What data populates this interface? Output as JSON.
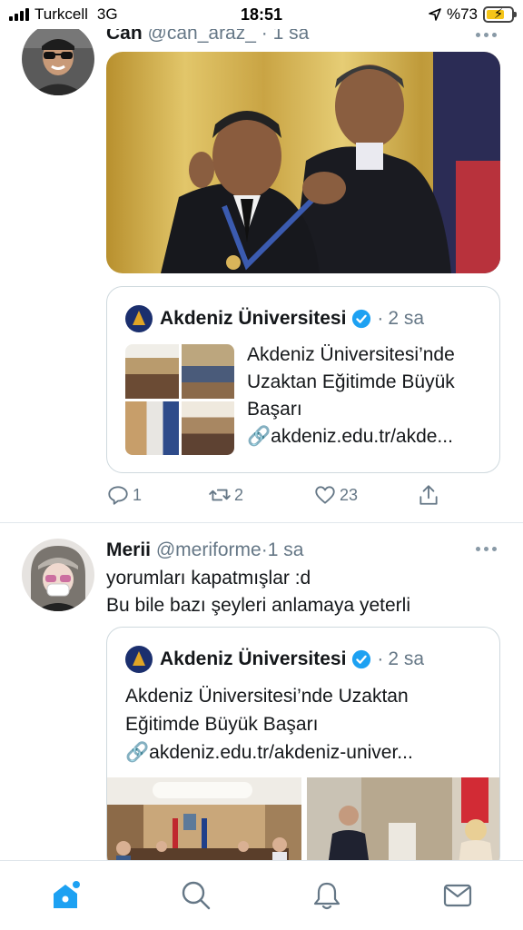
{
  "status_bar": {
    "carrier": "Turkcell",
    "network": "3G",
    "time": "18:51",
    "battery_text": "%73",
    "battery_level": 0.73
  },
  "tweets": [
    {
      "name": "Can",
      "handle": "@can_araz_",
      "separator": "·",
      "time": "1 sa",
      "image_alt": "Photo: medal ceremony",
      "quote": {
        "name": "Akdeniz Üniversitesi",
        "separator": "·",
        "time": "2 sa",
        "card_title": "Akdeniz Üniversitesi’nde Uzaktan Eğitimde Büyük Başarı",
        "card_link": "🔗akdeniz.edu.tr/akde..."
      },
      "actions": {
        "replies": "1",
        "retweets": "2",
        "likes": "23"
      }
    },
    {
      "name": "Merii",
      "handle": "@meriforme",
      "separator": "·",
      "time": "1 sa",
      "text_line1": "yorumları kapatmışlar :d",
      "text_line2": "Bu bile bazı şeyleri anlamaya yeterli",
      "quote": {
        "name": "Akdeniz Üniversitesi",
        "separator": "·",
        "time": "2 sa",
        "text_line1": "Akdeniz Üniversitesi’nde Uzaktan",
        "text_line2": "Eğitimde Büyük Başarı",
        "link": "🔗akdeniz.edu.tr/akdeniz-univer..."
      }
    }
  ],
  "tab_bar": {
    "items": [
      "home-icon",
      "search-icon",
      "notifications-icon",
      "messages-icon"
    ],
    "active": "home-icon"
  },
  "colors": {
    "accent": "#1da1f2",
    "secondary_text": "#657786",
    "border": "#cfd9de"
  }
}
